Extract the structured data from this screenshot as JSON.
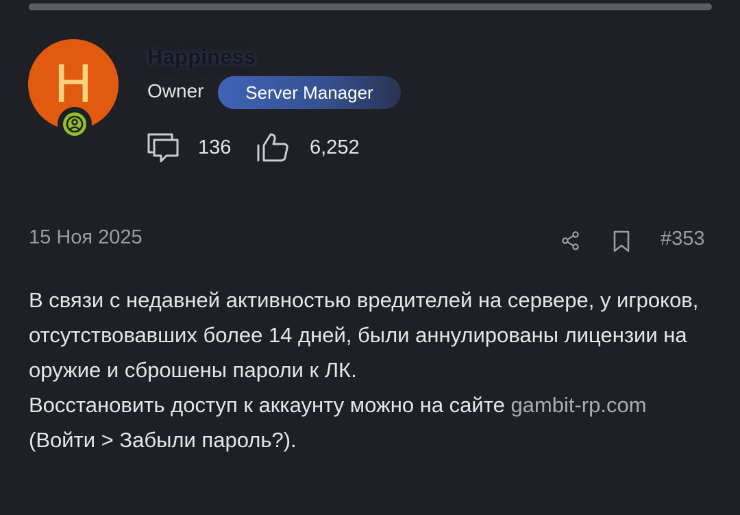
{
  "author": {
    "avatar_letter": "H",
    "avatar_color": "#e25a10",
    "name": "Happiness",
    "role": "Owner",
    "tag": "Server Manager",
    "status_icon": "online-user-icon",
    "messages_icon": "chat-icon",
    "messages_count": "136",
    "likes_icon": "thumbs-up-icon",
    "likes_count": "6,252"
  },
  "post": {
    "date": "15 Ноя 2025",
    "share_icon": "share-icon",
    "bookmark_icon": "bookmark-icon",
    "number": "#353",
    "body_paragraph_1": "В связи с недавней активностью вредителей на сервере, у игроков, отсутствовавших более 14 дней, были аннулированы лицензии на оружие и сброшены пароли к ЛК.",
    "body_paragraph_2_prefix": "Восстановить доступ к аккаунту можно на сайте ",
    "body_link": "gambit-rp.com",
    "body_paragraph_2_suffix": " (Войти > Забыли пароль?)."
  },
  "colors": {
    "background": "#1e2026",
    "tag_gradient_start": "#3f63b6",
    "online_status": "#8fbf2a",
    "muted_text": "#9a9da5"
  }
}
